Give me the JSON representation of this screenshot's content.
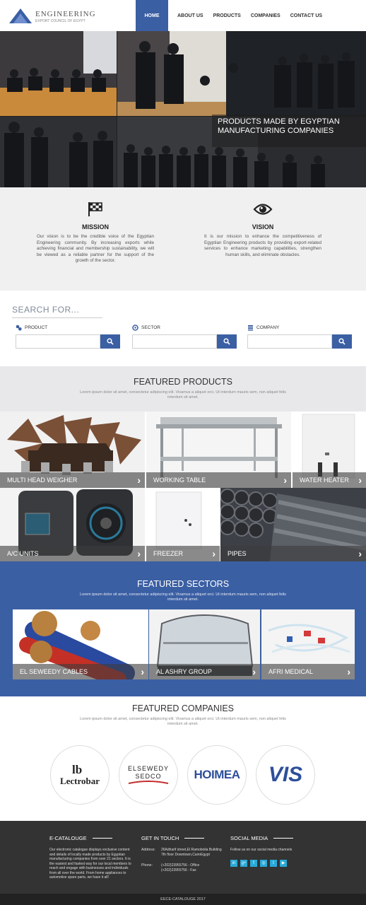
{
  "header": {
    "logo_main": "ENGINEERING",
    "logo_sub": "EXPORT COUNCIL OF EGYPT",
    "nav": [
      "HOME",
      "ABOUT US",
      "PRODUCTS",
      "COMPANIES",
      "CONTACT US"
    ],
    "active_nav": "HOME"
  },
  "hero": {
    "caption_line1": "PRODUCTS MADE BY EGYPTIAN",
    "caption_line2": "MANUFACTURING COMPANIES"
  },
  "mission": {
    "icon": "flag-icon",
    "title": "MISSION",
    "text": "Our vision is to be the credible voice of the Egyptian Engineering community. By increasing exports while achieving financial and membership sustainability, we will be viewed as a reliable partner for the support of the growth of the sector."
  },
  "vision": {
    "icon": "eye-icon",
    "title": "VISION",
    "text": "It is our mission to enhance the competitiveness of Egyptian Engineering products by providing export-related services to enhance marketing capabilities, strengthen human skills, and eliminate obstacles."
  },
  "search": {
    "title": "SEARCH FOR...",
    "fields": [
      {
        "label": "PRODUCT",
        "icon": "product-icon",
        "value": ""
      },
      {
        "label": "SECTOR",
        "icon": "sector-icon",
        "value": ""
      },
      {
        "label": "COMPANY",
        "icon": "company-icon",
        "value": ""
      }
    ]
  },
  "featured_products": {
    "title": "FEATURED PRODUCTS",
    "subtitle": "Lorem ipsum dolor sit amet, consectetur adipiscing elit. Vivamus a aliquet orci. Ut interdum mauris sem, non aliquet felis interdum sit amet.",
    "items": [
      "MULTI HEAD WEIGHER",
      "WORKING TABLE",
      "WATER HEATER",
      "A/C UNITS",
      "FREEZER",
      "PIPES"
    ]
  },
  "featured_sectors": {
    "title": "FEATURED SECTORS",
    "subtitle": "Lorem ipsum dolor sit amet, consectetur adipiscing elit. Vivamus a aliquet orci. Ut interdum mauris sem, non aliquet felis interdum sit amet.",
    "items": [
      "EL SEWEEDY CABLES",
      "AL ASHRY GROUP",
      "AFRI MEDICAL"
    ]
  },
  "featured_companies": {
    "title": "FEATURED COMPANIES",
    "subtitle": "Lorem ipsum dolor sit amet, consectetur adipiscing elit. Vivamus a aliquet orci. Ut interdum mauris sem, non aliquet felis interdum sit amet.",
    "logos": [
      "Lectrobar",
      "ELSEWEDY SEDCO",
      "HOIMEA",
      "VIS"
    ]
  },
  "footer": {
    "ecatalogue_title": "E-CATALOUGE",
    "ecatalogue_text": "Our electronic catalogue displays exclusive content and details of locally made products by Egyptian manufacturing companies from over 21 sectors. It is the easiest and fastest way for our local members to reach and engage with businesses and individuals from all over the world. From home appliances to automotive spare parts, we have it all!",
    "contact_title": "GET IN TOUCH",
    "address_label": "Address:",
    "address": "26Adharif street,El Ramoboila Building 7th floor Downtown,CairoEgypt",
    "phone_label": "Phone:",
    "phone1": "(+202)23955756 - Office",
    "phone2": "(+202)23955756 - Fax",
    "social_title": "SOCIAL MEDIA",
    "social_text": "Follow us on our social media channels",
    "social_icons": [
      "in",
      "g+",
      "f",
      "◎",
      "t",
      "▶"
    ],
    "copyright": "EECE-CATALOUGE 2017"
  }
}
